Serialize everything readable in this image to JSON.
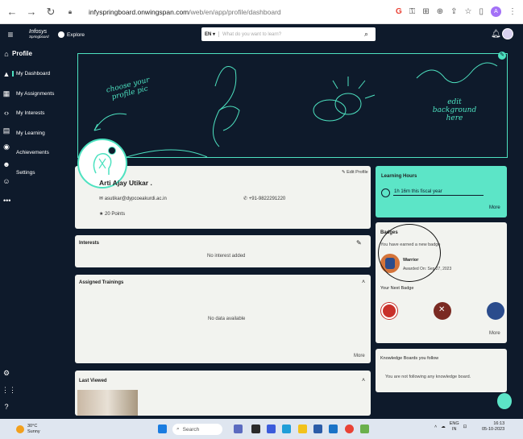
{
  "browser": {
    "url_host": "infyspringboard.onwingspan.com",
    "url_path": "/web/en/app/profile/dashboard",
    "profile_initial": "A"
  },
  "header": {
    "logo_line1": "Infosys",
    "logo_line2": "Springboard",
    "explore_label": "Explore",
    "language": "EN ▾",
    "search_placeholder": "What do you want to learn?"
  },
  "sidebar": {
    "title": "Profile",
    "items": [
      {
        "label": "My Dashboard"
      },
      {
        "label": "My Assignments"
      },
      {
        "label": "My Interests"
      },
      {
        "label": "My Learning"
      },
      {
        "label": "Achievements"
      },
      {
        "label": "Settings"
      }
    ],
    "more": "•••"
  },
  "banner": {
    "choose_pic": "choose your profile pic",
    "edit_bg_1": "edit",
    "edit_bg_2": "background",
    "edit_bg_3": "here"
  },
  "profile": {
    "name": "Arti Ajay Utikar .",
    "email": "asutikar@dypcoeakurdi.ac.in",
    "phone": "+91-9822291220",
    "points": "20 Points",
    "edit_label": "Edit Profile"
  },
  "interests": {
    "title": "Interests",
    "empty": "No interest added"
  },
  "trainings": {
    "title": "Assigned Trainings",
    "empty": "No data available",
    "more": "More"
  },
  "last_viewed": {
    "title": "Last Viewed"
  },
  "learning_hours": {
    "title": "Learning Hours",
    "value": "1h 16m  this fiscal year",
    "more": "More"
  },
  "badges": {
    "title": "Badges",
    "earned_text": "You have earned a new badge",
    "badge_name": "Warrior",
    "badge_date": "Awarded On: Sep 27, 2023",
    "next_title": "Your Next Badge",
    "more": "More"
  },
  "knowledge_boards": {
    "title": "Knowledge Boards you follow",
    "empty": "You are not following any knowledge board."
  },
  "taskbar": {
    "temp": "30°C",
    "weather": "Sunny",
    "search": "Search",
    "lang_1": "ENG",
    "lang_2": "IN",
    "time": "16:13",
    "date": "05-10-2023"
  },
  "colors": {
    "navy": "#0e1a2b",
    "teal": "#4de2c0",
    "card": "#f2f3ef"
  }
}
